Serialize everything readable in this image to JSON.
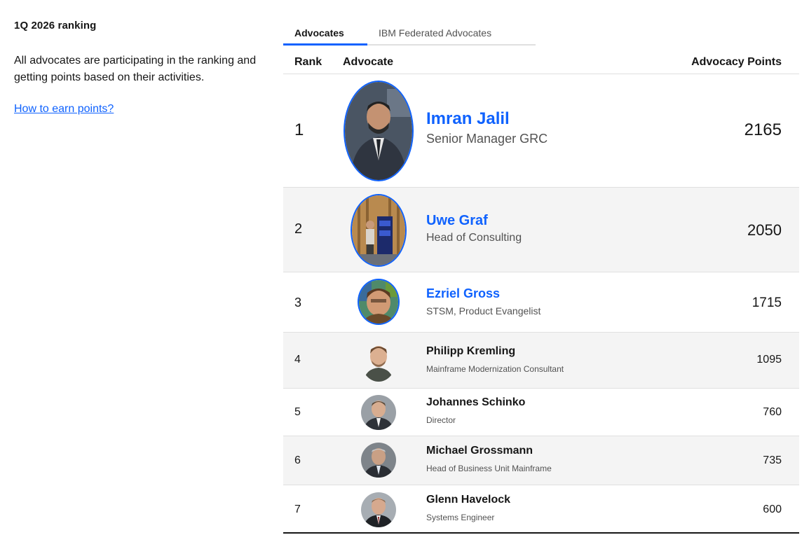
{
  "sidebar": {
    "heading": "1Q 2026 ranking",
    "description": "All advocates are participating in the ranking and getting points based on their activities.",
    "link_text": "How to earn points?"
  },
  "tabs": [
    {
      "label": "Advocates",
      "active": true
    },
    {
      "label": "IBM Federated Advocates",
      "active": false
    }
  ],
  "table": {
    "headers": {
      "rank": "Rank",
      "advocate": "Advocate",
      "points": "Advocacy Points"
    },
    "rows": [
      {
        "rank": "1",
        "name": "Imran Jalil",
        "title": "Senior Manager GRC",
        "points": "2165"
      },
      {
        "rank": "2",
        "name": "Uwe Graf",
        "title": "Head of Consulting",
        "points": "2050"
      },
      {
        "rank": "3",
        "name": "Ezriel Gross",
        "title": "STSM, Product Evangelist",
        "points": "1715"
      },
      {
        "rank": "4",
        "name": "Philipp Kremling",
        "title": "Mainframe Modernization Consultant",
        "points": "1095"
      },
      {
        "rank": "5",
        "name": "Johannes Schinko",
        "title": "Director",
        "points": "760"
      },
      {
        "rank": "6",
        "name": "Michael Grossmann",
        "title": "Head of Business Unit Mainframe",
        "points": "735"
      },
      {
        "rank": "7",
        "name": "Glenn Havelock",
        "title": "Systems Engineer",
        "points": "600"
      }
    ]
  },
  "colors": {
    "accent": "#0f62fe",
    "row_alt": "#f4f4f4",
    "divider": "#e0e0e0"
  }
}
